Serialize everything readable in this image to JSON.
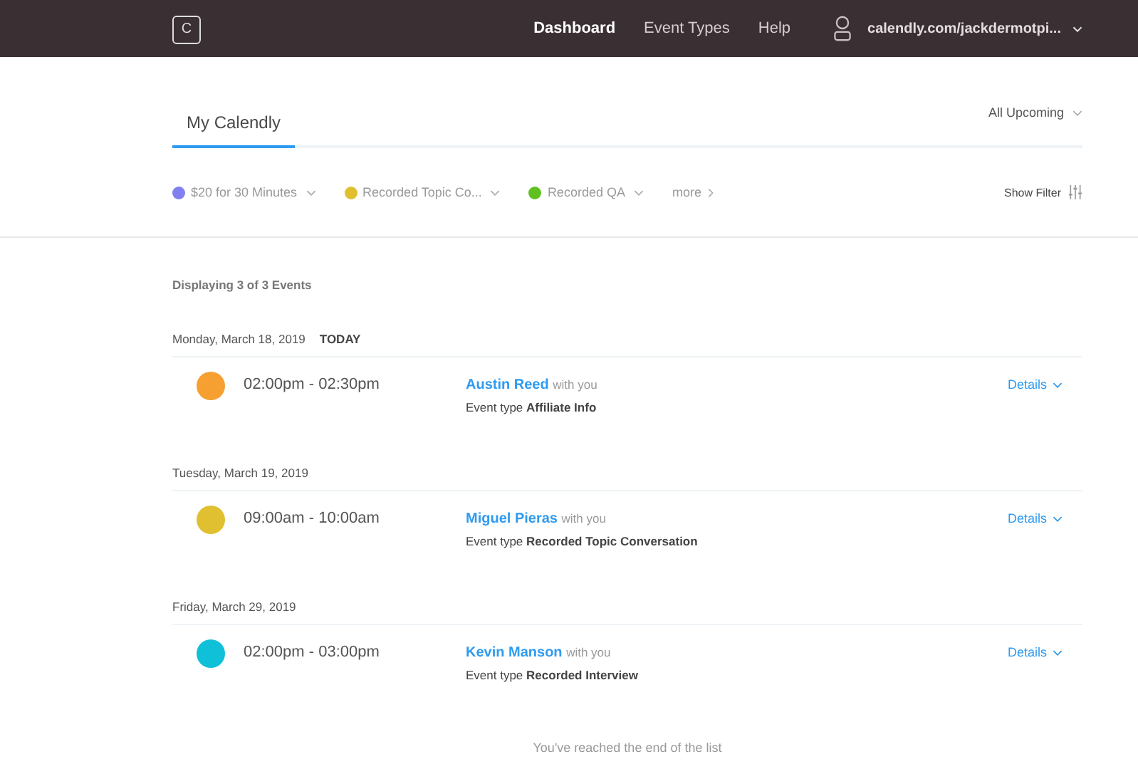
{
  "header": {
    "logo": "C",
    "nav": [
      {
        "label": "Dashboard",
        "selected": true
      },
      {
        "label": "Event Types",
        "selected": false
      },
      {
        "label": "Help",
        "selected": false
      }
    ],
    "account": "calendly.com/jackdermotpi..."
  },
  "tabs": [
    {
      "label": "My Calendly",
      "selected": true
    }
  ],
  "range": "All Upcoming",
  "filters": [
    {
      "label": "$20 for 30 Minutes",
      "color": "#8080f0"
    },
    {
      "label": "Recorded Topic Co...",
      "color": "#e0c030"
    },
    {
      "label": "Recorded QA",
      "color": "#60c020"
    }
  ],
  "more": "more",
  "show_filter": "Show Filter",
  "count": "Displaying 3 of 3 Events",
  "groups": [
    {
      "date": "Monday, March 18, 2019",
      "badge": "TODAY",
      "events": [
        {
          "color": "#f5a030",
          "time": "02:00pm - 02:30pm",
          "name": "Austin Reed",
          "with": "with you",
          "type": "Event type **Affiliate Info**",
          "details": "Details"
        }
      ]
    },
    {
      "date": "Tuesday, March 19, 2019",
      "events": [
        {
          "color": "#e0c030",
          "time": "09:00am - 10:00am",
          "name": "Miguel Pieras",
          "with": "with you",
          "type": "Event type **Recorded Topic Conversation**",
          "details": "Details"
        }
      ]
    },
    {
      "date": "Friday, March 29, 2019",
      "events": [
        {
          "color": "#10c0d8",
          "time": "02:00pm - 03:00pm",
          "name": "Kevin Manson",
          "with": "with you",
          "type": "Event type **Recorded Interview**",
          "details": "Details"
        }
      ]
    }
  ],
  "end_note": "You've reached the end of the list"
}
